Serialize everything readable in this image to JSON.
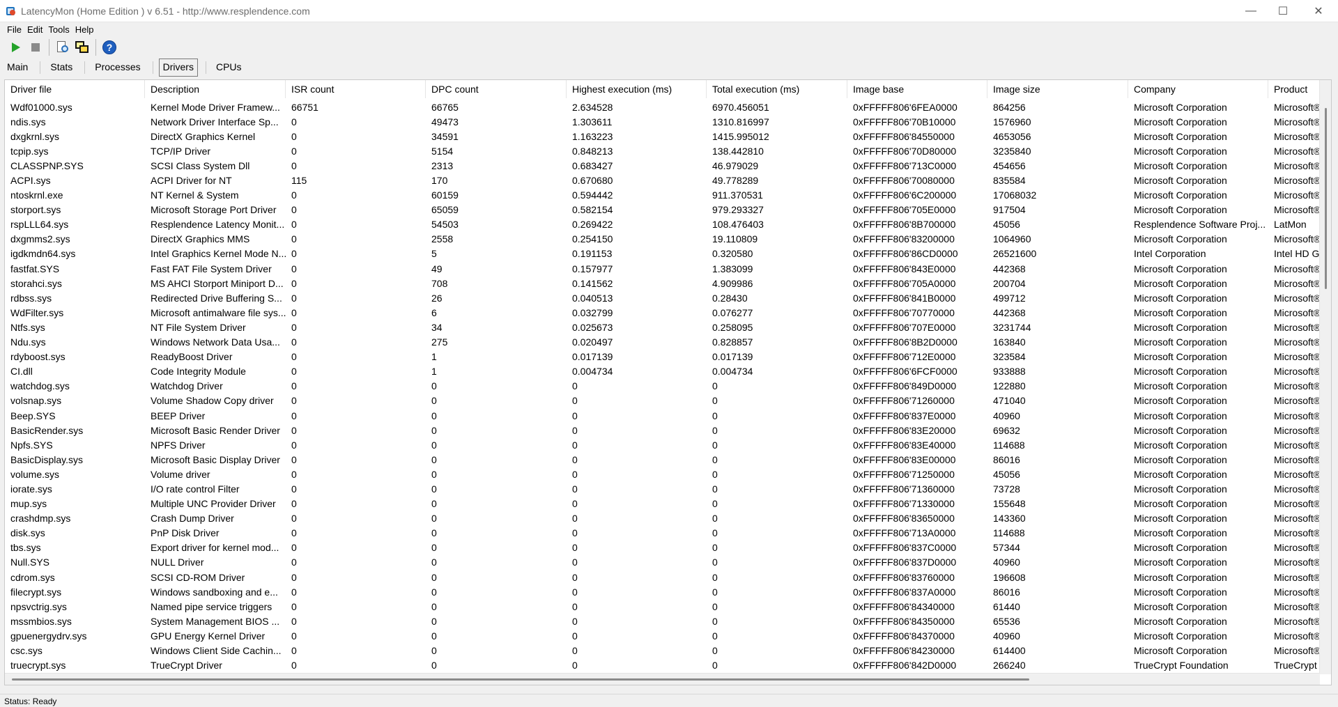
{
  "window": {
    "title": "LatencyMon  (Home Edition )  v 6.51 - http://www.resplendence.com",
    "minimize": "—",
    "maximize": "☐",
    "close": "✕"
  },
  "menu": [
    "File",
    "Edit",
    "Tools",
    "Help"
  ],
  "toolbar": {
    "icons": [
      "play-icon",
      "stop-icon",
      "report-icon",
      "windows-icon",
      "help-icon"
    ],
    "help_glyph": "?"
  },
  "tabs": [
    "Main",
    "Stats",
    "Processes",
    "Drivers",
    "CPUs"
  ],
  "active_tab": "Drivers",
  "table": {
    "columns": [
      "Driver file",
      "Description",
      "ISR count",
      "DPC count",
      "Highest execution (ms)",
      "Total execution (ms)",
      "Image base",
      "Image size",
      "Company",
      "Product"
    ],
    "rows": [
      [
        "Wdf01000.sys",
        "Kernel Mode Driver Framew...",
        "66751",
        "66765",
        "2.634528",
        "6970.456051",
        "0xFFFFF806'6FEA0000",
        "864256",
        "Microsoft Corporation",
        "Microsoft®"
      ],
      [
        "ndis.sys",
        "Network Driver Interface Sp...",
        "0",
        "49473",
        "1.303611",
        "1310.816997",
        "0xFFFFF806'70B10000",
        "1576960",
        "Microsoft Corporation",
        "Microsoft®"
      ],
      [
        "dxgkrnl.sys",
        "DirectX Graphics Kernel",
        "0",
        "34591",
        "1.163223",
        "1415.995012",
        "0xFFFFF806'84550000",
        "4653056",
        "Microsoft Corporation",
        "Microsoft®"
      ],
      [
        "tcpip.sys",
        "TCP/IP Driver",
        "0",
        "5154",
        "0.848213",
        "138.442810",
        "0xFFFFF806'70D80000",
        "3235840",
        "Microsoft Corporation",
        "Microsoft®"
      ],
      [
        "CLASSPNP.SYS",
        "SCSI Class System Dll",
        "0",
        "2313",
        "0.683427",
        "46.979029",
        "0xFFFFF806'713C0000",
        "454656",
        "Microsoft Corporation",
        "Microsoft®"
      ],
      [
        "ACPI.sys",
        "ACPI Driver for NT",
        "115",
        "170",
        "0.670680",
        "49.778289",
        "0xFFFFF806'70080000",
        "835584",
        "Microsoft Corporation",
        "Microsoft®"
      ],
      [
        "ntoskrnl.exe",
        "NT Kernel & System",
        "0",
        "60159",
        "0.594442",
        "911.370531",
        "0xFFFFF806'6C200000",
        "17068032",
        "Microsoft Corporation",
        "Microsoft®"
      ],
      [
        "storport.sys",
        "Microsoft Storage Port Driver",
        "0",
        "65059",
        "0.582154",
        "979.293327",
        "0xFFFFF806'705E0000",
        "917504",
        "Microsoft Corporation",
        "Microsoft®"
      ],
      [
        "rspLLL64.sys",
        "Resplendence Latency Monit...",
        "0",
        "54503",
        "0.269422",
        "108.476403",
        "0xFFFFF806'8B700000",
        "45056",
        "Resplendence Software Proj...",
        "LatMon"
      ],
      [
        "dxgmms2.sys",
        "DirectX Graphics MMS",
        "0",
        "2558",
        "0.254150",
        "19.110809",
        "0xFFFFF806'83200000",
        "1064960",
        "Microsoft Corporation",
        "Microsoft®"
      ],
      [
        "igdkmdn64.sys",
        "Intel Graphics Kernel Mode N...",
        "0",
        "5",
        "0.191153",
        "0.320580",
        "0xFFFFF806'86CD0000",
        "26521600",
        "Intel Corporation",
        "Intel HD Gra"
      ],
      [
        "fastfat.SYS",
        "Fast FAT File System Driver",
        "0",
        "49",
        "0.157977",
        "1.383099",
        "0xFFFFF806'843E0000",
        "442368",
        "Microsoft Corporation",
        "Microsoft®"
      ],
      [
        "storahci.sys",
        "MS AHCI Storport Miniport D...",
        "0",
        "708",
        "0.141562",
        "4.909986",
        "0xFFFFF806'705A0000",
        "200704",
        "Microsoft Corporation",
        "Microsoft®"
      ],
      [
        "rdbss.sys",
        "Redirected Drive Buffering S...",
        "0",
        "26",
        "0.040513",
        "0.28430",
        "0xFFFFF806'841B0000",
        "499712",
        "Microsoft Corporation",
        "Microsoft®"
      ],
      [
        "WdFilter.sys",
        "Microsoft antimalware file sys...",
        "0",
        "6",
        "0.032799",
        "0.076277",
        "0xFFFFF806'70770000",
        "442368",
        "Microsoft Corporation",
        "Microsoft®"
      ],
      [
        "Ntfs.sys",
        "NT File System Driver",
        "0",
        "34",
        "0.025673",
        "0.258095",
        "0xFFFFF806'707E0000",
        "3231744",
        "Microsoft Corporation",
        "Microsoft®"
      ],
      [
        "Ndu.sys",
        "Windows Network Data Usa...",
        "0",
        "275",
        "0.020497",
        "0.828857",
        "0xFFFFF806'8B2D0000",
        "163840",
        "Microsoft Corporation",
        "Microsoft®"
      ],
      [
        "rdyboost.sys",
        "ReadyBoost Driver",
        "0",
        "1",
        "0.017139",
        "0.017139",
        "0xFFFFF806'712E0000",
        "323584",
        "Microsoft Corporation",
        "Microsoft®"
      ],
      [
        "CI.dll",
        "Code Integrity Module",
        "0",
        "1",
        "0.004734",
        "0.004734",
        "0xFFFFF806'6FCF0000",
        "933888",
        "Microsoft Corporation",
        "Microsoft®"
      ],
      [
        "watchdog.sys",
        "Watchdog Driver",
        "0",
        "0",
        "0",
        "0",
        "0xFFFFF806'849D0000",
        "122880",
        "Microsoft Corporation",
        "Microsoft®"
      ],
      [
        "volsnap.sys",
        "Volume Shadow Copy driver",
        "0",
        "0",
        "0",
        "0",
        "0xFFFFF806'71260000",
        "471040",
        "Microsoft Corporation",
        "Microsoft®"
      ],
      [
        "Beep.SYS",
        "BEEP Driver",
        "0",
        "0",
        "0",
        "0",
        "0xFFFFF806'837E0000",
        "40960",
        "Microsoft Corporation",
        "Microsoft®"
      ],
      [
        "BasicRender.sys",
        "Microsoft Basic Render Driver",
        "0",
        "0",
        "0",
        "0",
        "0xFFFFF806'83E20000",
        "69632",
        "Microsoft Corporation",
        "Microsoft®"
      ],
      [
        "Npfs.SYS",
        "NPFS Driver",
        "0",
        "0",
        "0",
        "0",
        "0xFFFFF806'83E40000",
        "114688",
        "Microsoft Corporation",
        "Microsoft®"
      ],
      [
        "BasicDisplay.sys",
        "Microsoft Basic Display Driver",
        "0",
        "0",
        "0",
        "0",
        "0xFFFFF806'83E00000",
        "86016",
        "Microsoft Corporation",
        "Microsoft®"
      ],
      [
        "volume.sys",
        "Volume driver",
        "0",
        "0",
        "0",
        "0",
        "0xFFFFF806'71250000",
        "45056",
        "Microsoft Corporation",
        "Microsoft®"
      ],
      [
        "iorate.sys",
        "I/O rate control Filter",
        "0",
        "0",
        "0",
        "0",
        "0xFFFFF806'71360000",
        "73728",
        "Microsoft Corporation",
        "Microsoft®"
      ],
      [
        "mup.sys",
        "Multiple UNC Provider Driver",
        "0",
        "0",
        "0",
        "0",
        "0xFFFFF806'71330000",
        "155648",
        "Microsoft Corporation",
        "Microsoft®"
      ],
      [
        "crashdmp.sys",
        "Crash Dump Driver",
        "0",
        "0",
        "0",
        "0",
        "0xFFFFF806'83650000",
        "143360",
        "Microsoft Corporation",
        "Microsoft®"
      ],
      [
        "disk.sys",
        "PnP Disk Driver",
        "0",
        "0",
        "0",
        "0",
        "0xFFFFF806'713A0000",
        "114688",
        "Microsoft Corporation",
        "Microsoft®"
      ],
      [
        "tbs.sys",
        "Export driver for kernel mod...",
        "0",
        "0",
        "0",
        "0",
        "0xFFFFF806'837C0000",
        "57344",
        "Microsoft Corporation",
        "Microsoft®"
      ],
      [
        "Null.SYS",
        "NULL Driver",
        "0",
        "0",
        "0",
        "0",
        "0xFFFFF806'837D0000",
        "40960",
        "Microsoft Corporation",
        "Microsoft®"
      ],
      [
        "cdrom.sys",
        "SCSI CD-ROM Driver",
        "0",
        "0",
        "0",
        "0",
        "0xFFFFF806'83760000",
        "196608",
        "Microsoft Corporation",
        "Microsoft®"
      ],
      [
        "filecrypt.sys",
        "Windows sandboxing and e...",
        "0",
        "0",
        "0",
        "0",
        "0xFFFFF806'837A0000",
        "86016",
        "Microsoft Corporation",
        "Microsoft®"
      ],
      [
        "npsvctrig.sys",
        "Named pipe service triggers",
        "0",
        "0",
        "0",
        "0",
        "0xFFFFF806'84340000",
        "61440",
        "Microsoft Corporation",
        "Microsoft®"
      ],
      [
        "mssmbios.sys",
        "System Management BIOS ...",
        "0",
        "0",
        "0",
        "0",
        "0xFFFFF806'84350000",
        "65536",
        "Microsoft Corporation",
        "Microsoft®"
      ],
      [
        "gpuenergydrv.sys",
        "GPU Energy Kernel Driver",
        "0",
        "0",
        "0",
        "0",
        "0xFFFFF806'84370000",
        "40960",
        "Microsoft Corporation",
        "Microsoft®"
      ],
      [
        "csc.sys",
        "Windows Client Side Cachin...",
        "0",
        "0",
        "0",
        "0",
        "0xFFFFF806'84230000",
        "614400",
        "Microsoft Corporation",
        "Microsoft®"
      ],
      [
        "truecrypt.sys",
        "TrueCrypt Driver",
        "0",
        "0",
        "0",
        "0",
        "0xFFFFF806'842D0000",
        "266240",
        "TrueCrypt Foundation",
        "TrueCrypt"
      ]
    ]
  },
  "status": "Status: Ready"
}
